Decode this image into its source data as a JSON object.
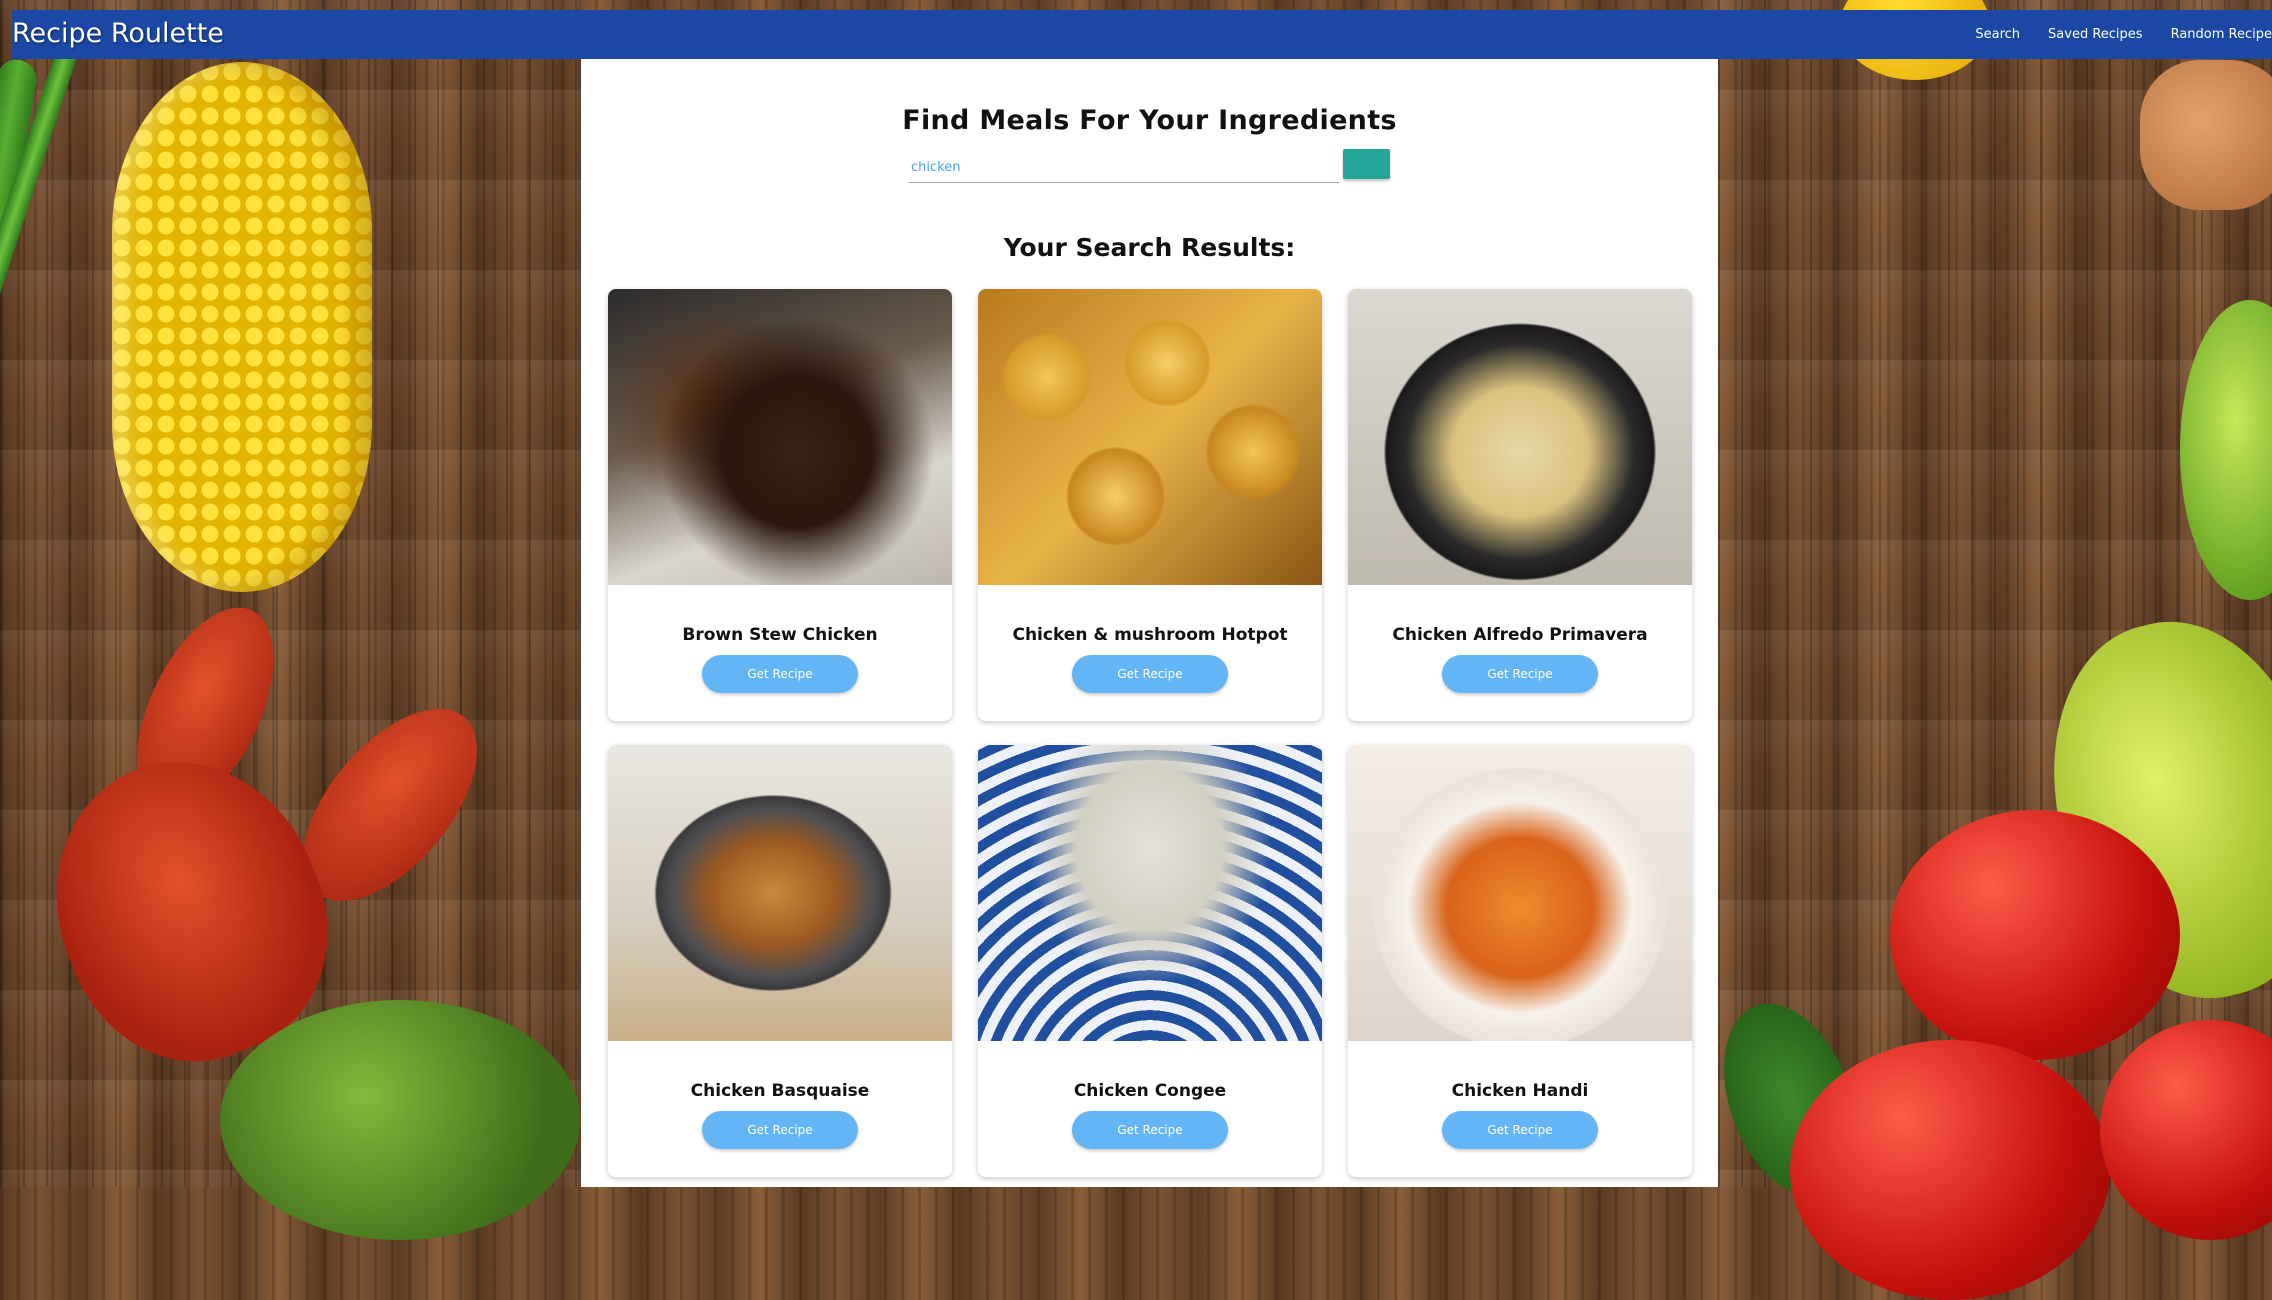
{
  "navbar": {
    "brand": "Recipe Roulette",
    "links": [
      "Search",
      "Saved Recipes",
      "Random Recipe"
    ]
  },
  "search": {
    "heading": "Find Meals For Your Ingredients",
    "query": "chicken",
    "results_title": "Your Search Results:"
  },
  "results": [
    {
      "title": "Brown Stew Chicken",
      "button": "Get Recipe"
    },
    {
      "title": "Chicken & mushroom Hotpot",
      "button": "Get Recipe"
    },
    {
      "title": "Chicken Alfredo Primavera",
      "button": "Get Recipe"
    },
    {
      "title": "Chicken Basquaise",
      "button": "Get Recipe"
    },
    {
      "title": "Chicken Congee",
      "button": "Get Recipe"
    },
    {
      "title": "Chicken Handi",
      "button": "Get Recipe"
    }
  ],
  "colors": {
    "navbar": "#1a48a4",
    "search_button": "#26a69a",
    "recipe_button": "#64b5f6"
  }
}
